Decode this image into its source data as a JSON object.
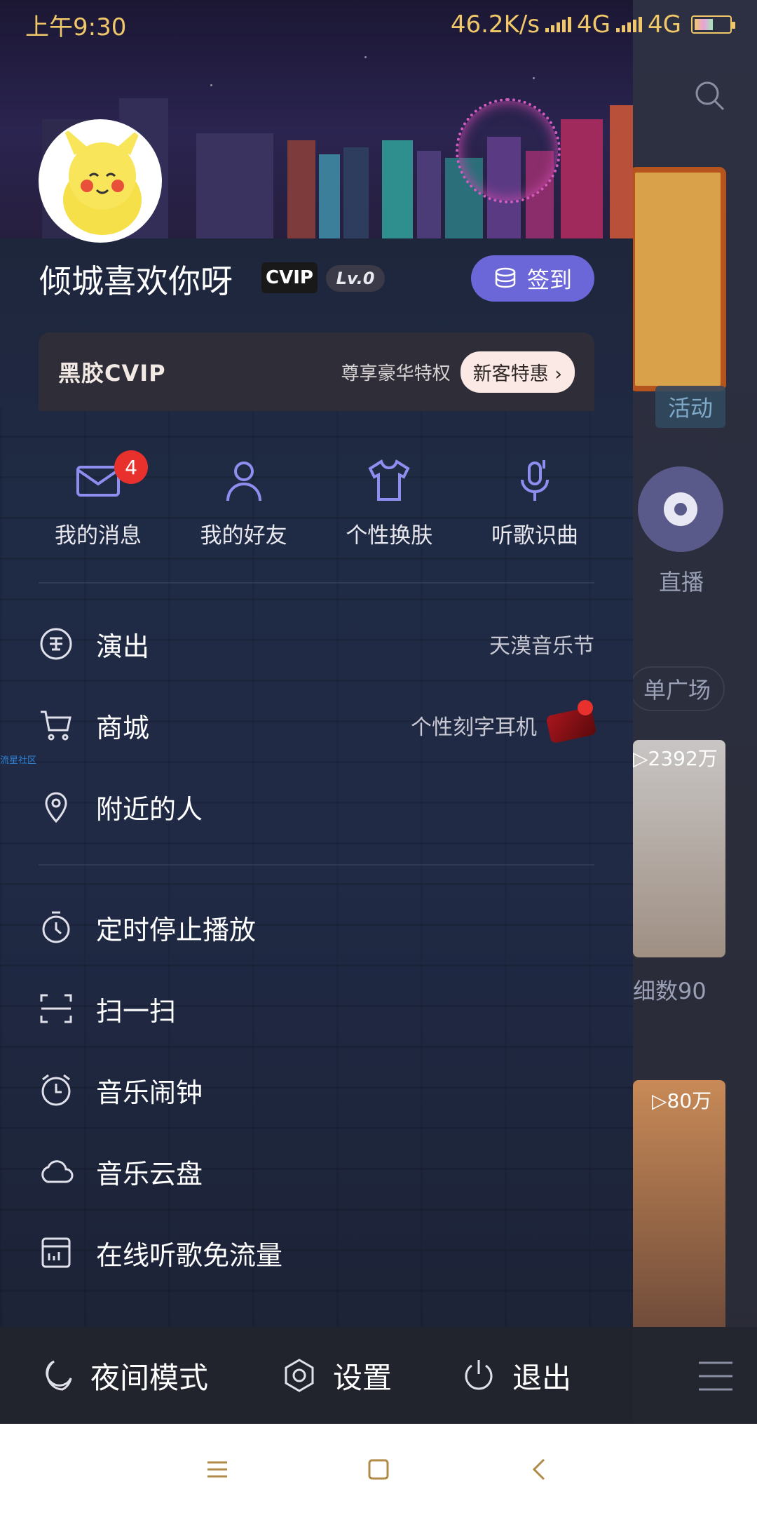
{
  "status_bar": {
    "time": "上午9:30",
    "speed": "46.2K/s",
    "network1": "4G",
    "network2": "4G"
  },
  "background_app": {
    "activity_tag": "活动",
    "live_label": "直播",
    "square_label": "单广场",
    "play_count1": "▷2392万",
    "title1": "细数90",
    "play_count2": "▷80万"
  },
  "profile": {
    "username": "倾城喜欢你呀",
    "vip_badge": "CVIP",
    "level": "Lv.0",
    "checkin_label": "签到"
  },
  "vip_banner": {
    "brand": "黑胶CVIP",
    "privilege": "尊享豪华特权",
    "promo": "新客特惠 ›"
  },
  "quick_actions": [
    {
      "label": "我的消息",
      "badge": "4",
      "icon": "mail-icon"
    },
    {
      "label": "我的好友",
      "icon": "friend-icon"
    },
    {
      "label": "个性换肤",
      "icon": "tshirt-icon"
    },
    {
      "label": "听歌识曲",
      "icon": "mic-note-icon"
    }
  ],
  "menu": [
    {
      "label": "演出",
      "aux": "天漠音乐节",
      "icon": "ticket-icon"
    },
    {
      "label": "商城",
      "aux": "个性刻字耳机",
      "icon": "cart-icon"
    },
    {
      "label": "附近的人",
      "icon": "location-icon"
    },
    {
      "label": "定时停止播放",
      "icon": "timer-icon"
    },
    {
      "label": "扫一扫",
      "icon": "scan-icon"
    },
    {
      "label": "音乐闹钟",
      "icon": "alarm-icon"
    },
    {
      "label": "音乐云盘",
      "icon": "cloud-icon"
    },
    {
      "label": "在线听歌免流量",
      "icon": "sim-icon"
    }
  ],
  "community_tag": "流星社区",
  "bottom": {
    "night_mode": "夜间模式",
    "settings": "设置",
    "logout": "退出"
  }
}
